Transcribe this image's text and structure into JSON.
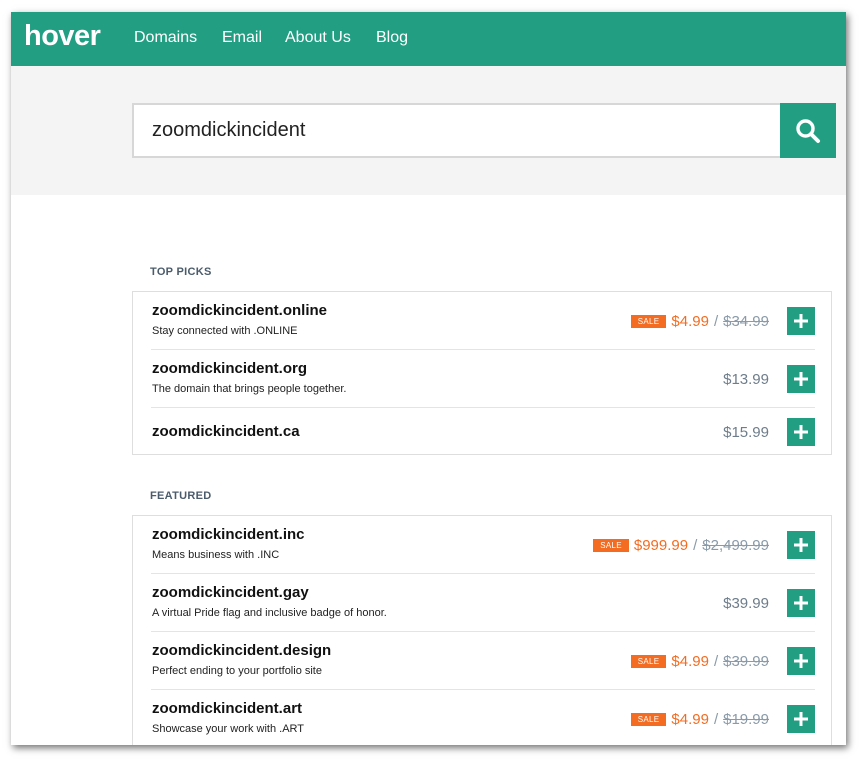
{
  "brand": {
    "logo_text": "hover",
    "accent": "#229e83",
    "sale_color": "#f36c21"
  },
  "nav": {
    "items": [
      "Domains",
      "Email",
      "About Us",
      "Blog"
    ]
  },
  "search": {
    "value": "zoomdickincident",
    "button_icon": "search-icon"
  },
  "sections": [
    {
      "title": "TOP PICKS",
      "results": [
        {
          "domain": "zoomdickincident.online",
          "description": "Stay connected with .ONLINE",
          "sale_label": "SALE",
          "price": "$4.99",
          "separator": "/",
          "old_price": "$34.99"
        },
        {
          "domain": "zoomdickincident.org",
          "description": "The domain that brings people together.",
          "price": "$13.99"
        },
        {
          "domain": "zoomdickincident.ca",
          "price": "$15.99"
        }
      ]
    },
    {
      "title": "FEATURED",
      "results": [
        {
          "domain": "zoomdickincident.inc",
          "description": "Means business with .INC",
          "sale_label": "SALE",
          "price": "$999.99",
          "separator": "/",
          "old_price": "$2,499.99"
        },
        {
          "domain": "zoomdickincident.gay",
          "description": "A virtual Pride flag and inclusive badge of honor.",
          "price": "$39.99"
        },
        {
          "domain": "zoomdickincident.design",
          "description": "Perfect ending to your portfolio site",
          "sale_label": "SALE",
          "price": "$4.99",
          "separator": "/",
          "old_price": "$39.99"
        },
        {
          "domain": "zoomdickincident.art",
          "description": "Showcase your work with .ART",
          "sale_label": "SALE",
          "price": "$4.99",
          "separator": "/",
          "old_price": "$19.99"
        }
      ]
    }
  ]
}
